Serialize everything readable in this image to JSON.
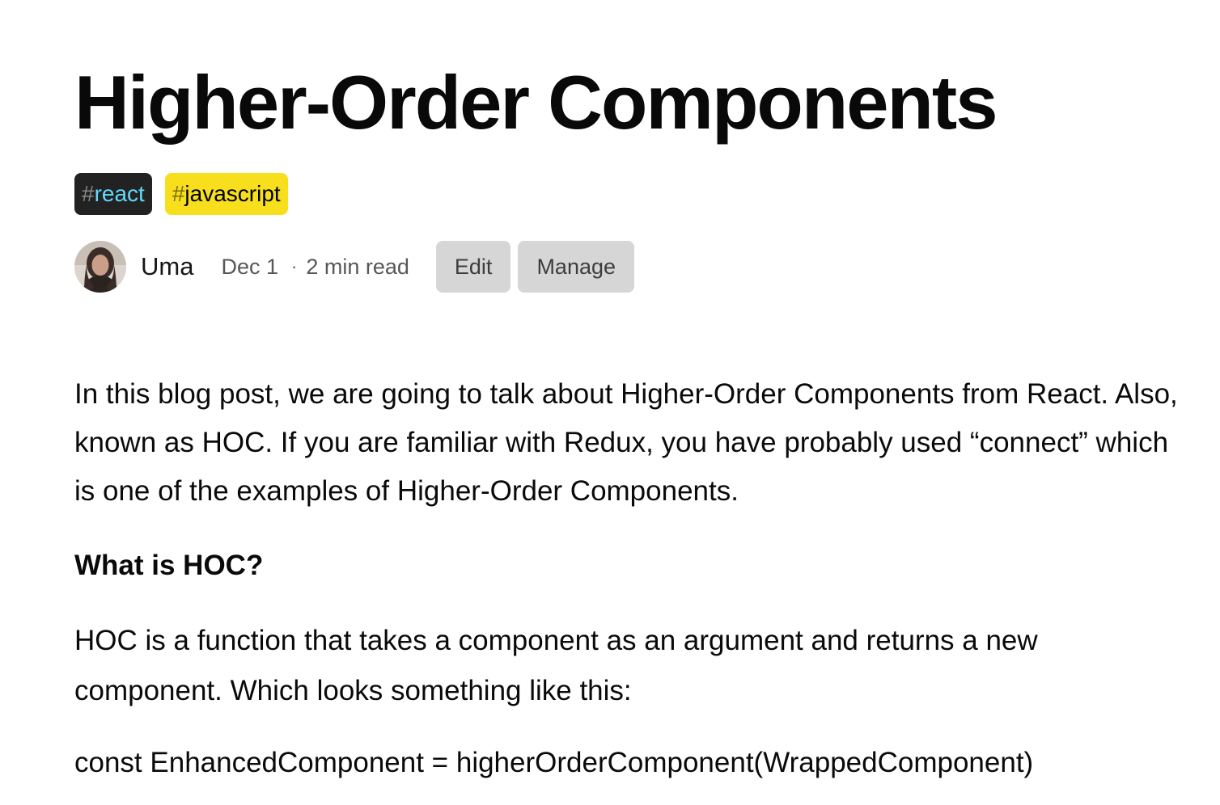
{
  "article": {
    "title": "Higher-Order Components",
    "tags": [
      {
        "hash": "#",
        "name": "react"
      },
      {
        "hash": "#",
        "name": "javascript"
      }
    ],
    "author": "Uma",
    "date": "Dec 1",
    "separator": "·",
    "read_time": "2 min read",
    "actions": {
      "edit_label": "Edit",
      "manage_label": "Manage"
    },
    "body": {
      "intro": "In this blog post, we are going to talk about Higher-Order Components from React. Also, known as HOC. If you are familiar with Redux, you have probably used “connect” which is one of the examples of Higher-Order Components.",
      "heading": "What is HOC?",
      "definition": "HOC is a function that takes a component as an argument and returns a new component. Which looks something like this:",
      "code_line": "const EnhancedComponent = higherOrderComponent(WrappedComponent)"
    }
  },
  "colors": {
    "react_tag_bg": "#222222",
    "react_tag_text": "#61dafb",
    "javascript_tag_bg": "#f7df1e",
    "button_bg": "#d6d6d7"
  }
}
